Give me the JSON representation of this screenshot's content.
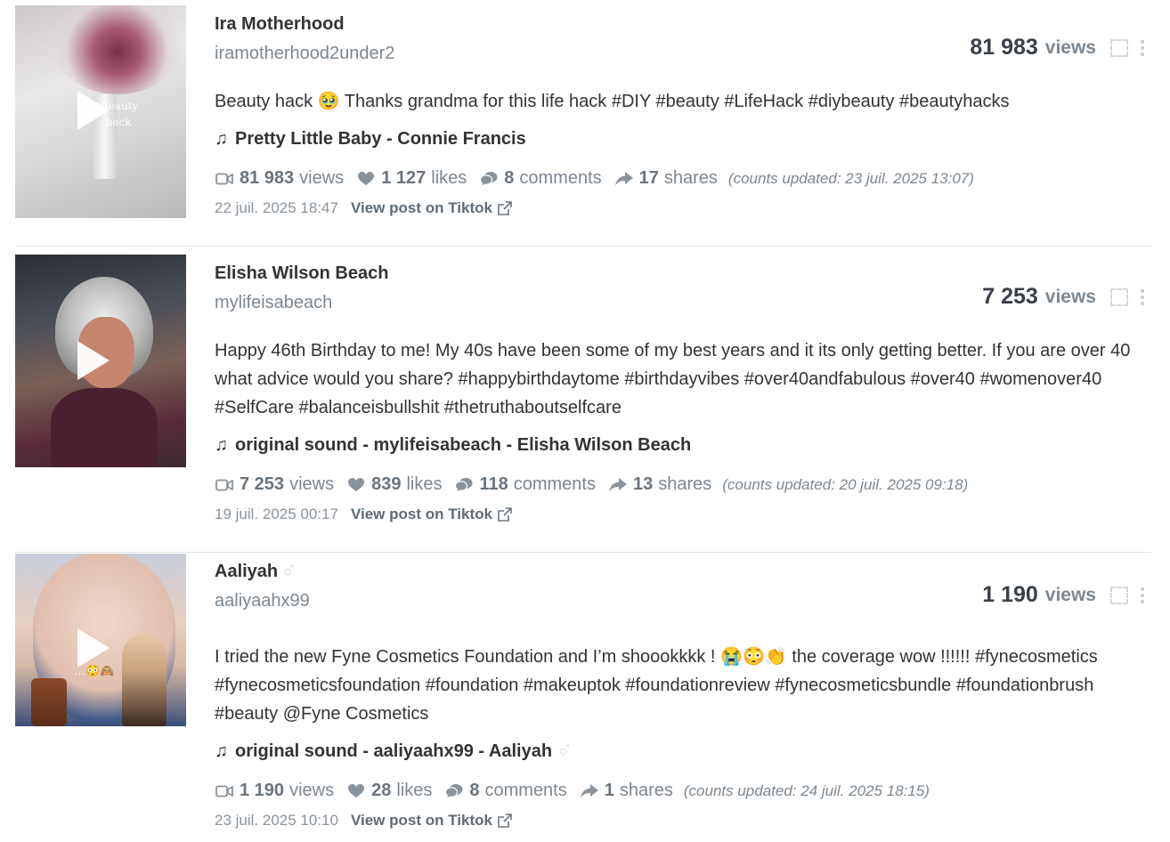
{
  "posts": [
    {
      "author": "Ira Motherhood",
      "verified": false,
      "handle": "iramotherhood2under2",
      "views_number": "81 983",
      "views_label": "views",
      "description": "Beauty hack 🥹 Thanks grandma for this life hack #DIY #beauty #LifeHack #diybeauty #beautyhacks",
      "music": "Pretty Little Baby - Connie Francis",
      "stats": {
        "views": "81 983",
        "views_label": "views",
        "likes": "1 127",
        "likes_label": "likes",
        "comments": "8",
        "comments_label": "comments",
        "shares": "17",
        "shares_label": "shares"
      },
      "updated_prefix": "(counts updated: ",
      "updated_date": "23 juil. 2025 13:07",
      "updated_suffix": ")",
      "posted_date": "22 juil. 2025 18:47",
      "link_label": "View post on Tiktok",
      "thumb_text": "Beauty hack"
    },
    {
      "author": "Elisha Wilson Beach",
      "verified": false,
      "handle": "mylifeisabeach",
      "views_number": "7 253",
      "views_label": "views",
      "description": "Happy 46th Birthday to me! My 40s have been some of my best years and it its only getting better. If you are over 40 what advice would you share? #happybirthdaytome #birthdayvibes #over40andfabulous #over40 #womenover40 #SelfCare #balanceisbullshit #thetruthaboutselfcare",
      "music": "original sound - mylifeisabeach - Elisha Wilson Beach",
      "stats": {
        "views": "7 253",
        "views_label": "views",
        "likes": "839",
        "likes_label": "likes",
        "comments": "118",
        "comments_label": "comments",
        "shares": "13",
        "shares_label": "shares"
      },
      "updated_prefix": "(counts updated: ",
      "updated_date": "20 juil. 2025 09:18",
      "updated_suffix": ")",
      "posted_date": "19 juil. 2025 00:17",
      "link_label": "View post on Tiktok"
    },
    {
      "author": "Aaliyah",
      "verified": true,
      "verified_glyph": "○̊",
      "handle": "aaliyaahx99",
      "views_number": "1 190",
      "views_label": "views",
      "description": "I tried the new Fyne Cosmetics Foundation and I’m shoookkkk ! 😭😳👏 the coverage wow !!!!!! #fynecosmetics #fynecosmeticsfoundation #foundation #makeuptok #foundationreview #fynecosmeticsbundle #foundationbrush #beauty @Fyne Cosmetics",
      "music": "original sound - aaliyaahx99 - Aaliyah",
      "stats": {
        "views": "1 190",
        "views_label": "views",
        "likes": "28",
        "likes_label": "likes",
        "comments": "8",
        "comments_label": "comments",
        "shares": "1",
        "shares_label": "shares"
      },
      "updated_prefix": "(counts updated: ",
      "updated_date": "24 juil. 2025 18:15",
      "updated_suffix": ")",
      "posted_date": "23 juil. 2025 10:10",
      "link_label": "View post on Tiktok",
      "thumb_emoji": "…😳🙈"
    }
  ],
  "icons": {
    "video": "video-camera-icon",
    "heart": "heart-icon",
    "comment": "comment-icon",
    "share": "share-arrow-icon",
    "music": "music-note-icon",
    "external": "external-link-icon",
    "expand": "expand-icon",
    "more": "more-vertical-icon",
    "play": "play-icon"
  }
}
